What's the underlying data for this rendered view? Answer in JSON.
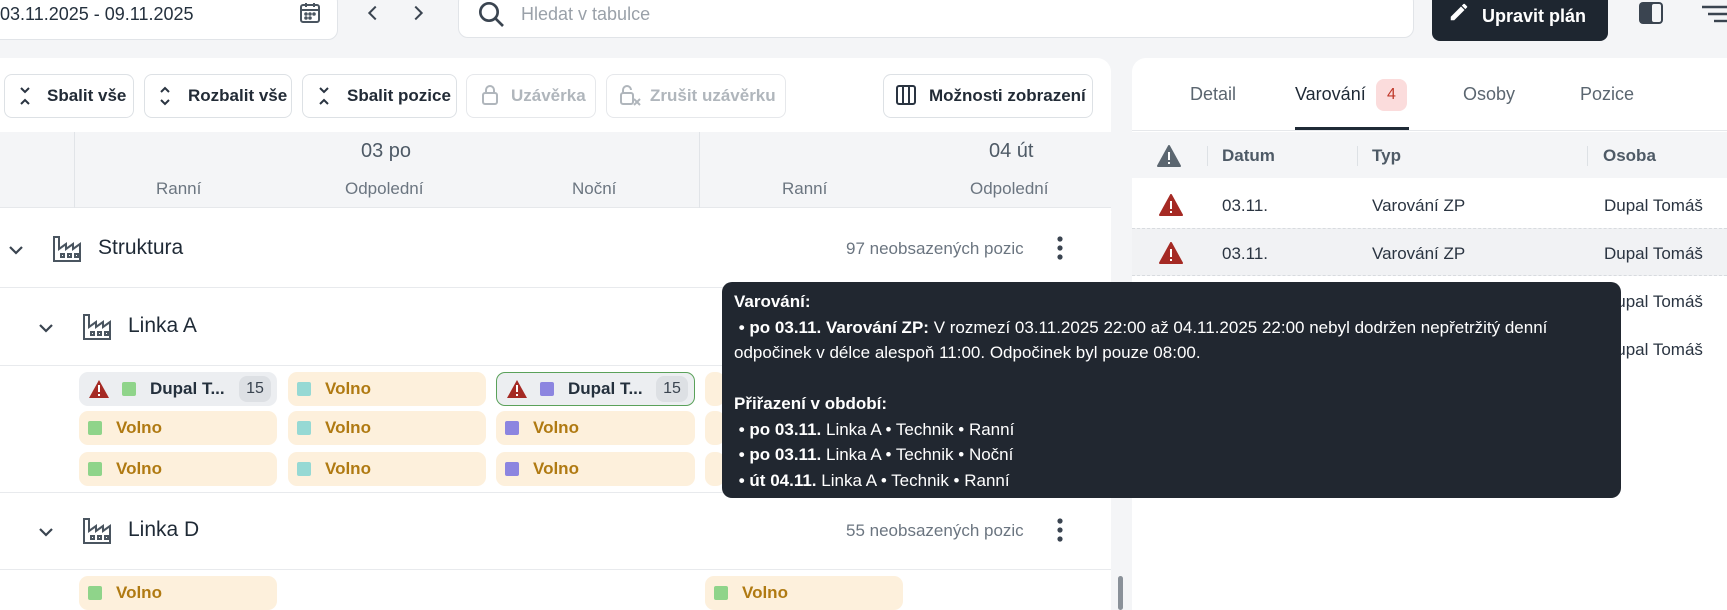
{
  "toolbar": {
    "date_range": "03.11.2025 - 09.11.2025",
    "search_placeholder": "Hledat v tabulce",
    "edit_plan_label": "Upravit plán"
  },
  "actions": {
    "collapse_all": "Sbalit vše",
    "expand_all": "Rozbalit vše",
    "collapse_positions": "Sbalit pozice",
    "closing": "Uzávěrka",
    "cancel_closing": "Zrušit uzávěrku",
    "display_options": "Možnosti zobrazení"
  },
  "grid": {
    "days": [
      {
        "label": "03 po",
        "shifts": [
          "Ranní",
          "Odpolední",
          "Noční"
        ]
      },
      {
        "label": "04 út",
        "shifts": [
          "Ranní",
          "Odpolední"
        ]
      }
    ],
    "groups": [
      {
        "title": "Struktura",
        "unfilled": "97 neobsazených pozic"
      },
      {
        "title": "Linka A"
      },
      {
        "title": "Linka D",
        "unfilled": "55 neobsazených pozic"
      }
    ],
    "cells": {
      "person_name": "Dupal T...",
      "person_count": "15",
      "free_label": "Volno"
    }
  },
  "right_panel": {
    "tabs": [
      "Detail",
      "Varování",
      "Osoby",
      "Pozice"
    ],
    "active_tab": "Varování",
    "warning_count": "4",
    "columns": [
      "Datum",
      "Typ",
      "Osoba"
    ],
    "rows": [
      {
        "date": "03.11.",
        "type": "Varování ZP",
        "person": "Dupal Tomáš"
      },
      {
        "date": "03.11.",
        "type": "Varování ZP",
        "person": "Dupal Tomáš"
      },
      {
        "date": "",
        "type": "",
        "person": "Dupal Tomáš"
      },
      {
        "date": "",
        "type": "",
        "person": "Dupal Tomáš"
      }
    ]
  },
  "tooltip": {
    "title": "Varování:",
    "warning_prefix": "po 03.11. Varování ZP:",
    "warning_text": "V rozmezí 03.11.2025 22:00 až 04.11.2025 22:00 nebyl dodržen nepřetržitý denní odpočinek v délce alespoň 11:00. Odpočinek byl pouze 08:00.",
    "assign_title": "Přiřazení v období:",
    "assignments": [
      {
        "day": "po 03.11.",
        "detail": "Linka A • Technik • Ranní"
      },
      {
        "day": "po 03.11.",
        "detail": "Linka A • Technik • Noční"
      },
      {
        "day": "út 04.11.",
        "detail": "Linka A • Technik • Ranní"
      }
    ]
  },
  "colors": {
    "accent_dark": "#1e2630",
    "warning_red": "#b3261e",
    "free_bg": "#fdf0dc",
    "free_text": "#b07a12"
  }
}
